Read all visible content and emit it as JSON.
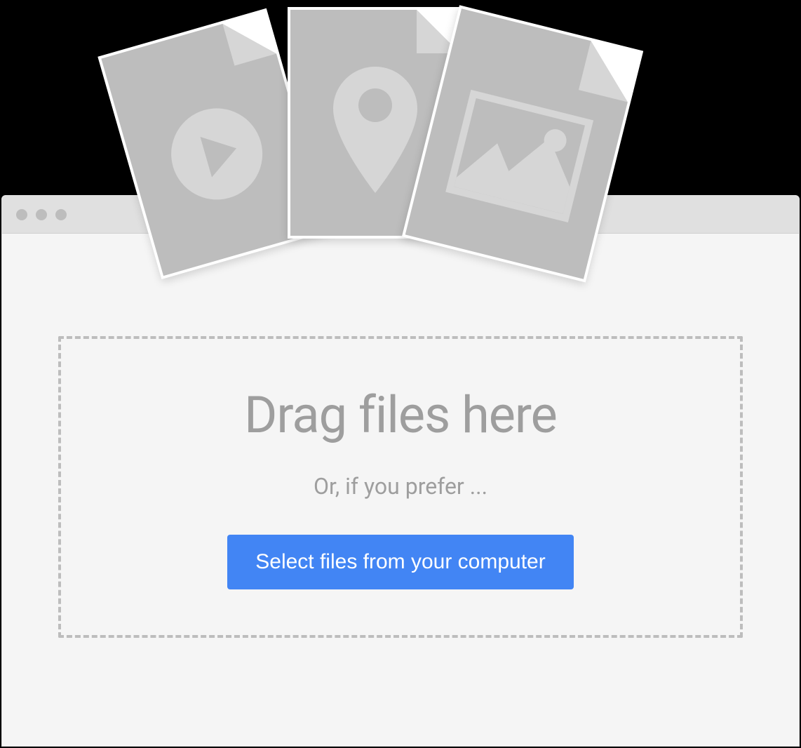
{
  "dropzone": {
    "title": "Drag files here",
    "subtitle": "Or, if you prefer ...",
    "button_label": "Select files from your computer"
  },
  "file_cards": [
    {
      "type": "video"
    },
    {
      "type": "location"
    },
    {
      "type": "image"
    }
  ],
  "colors": {
    "button_bg": "#4285f4",
    "button_text": "#ffffff",
    "muted_text": "#9e9e9e",
    "card_bg": "#bdbdbd",
    "card_accent": "#d6d6d6"
  }
}
